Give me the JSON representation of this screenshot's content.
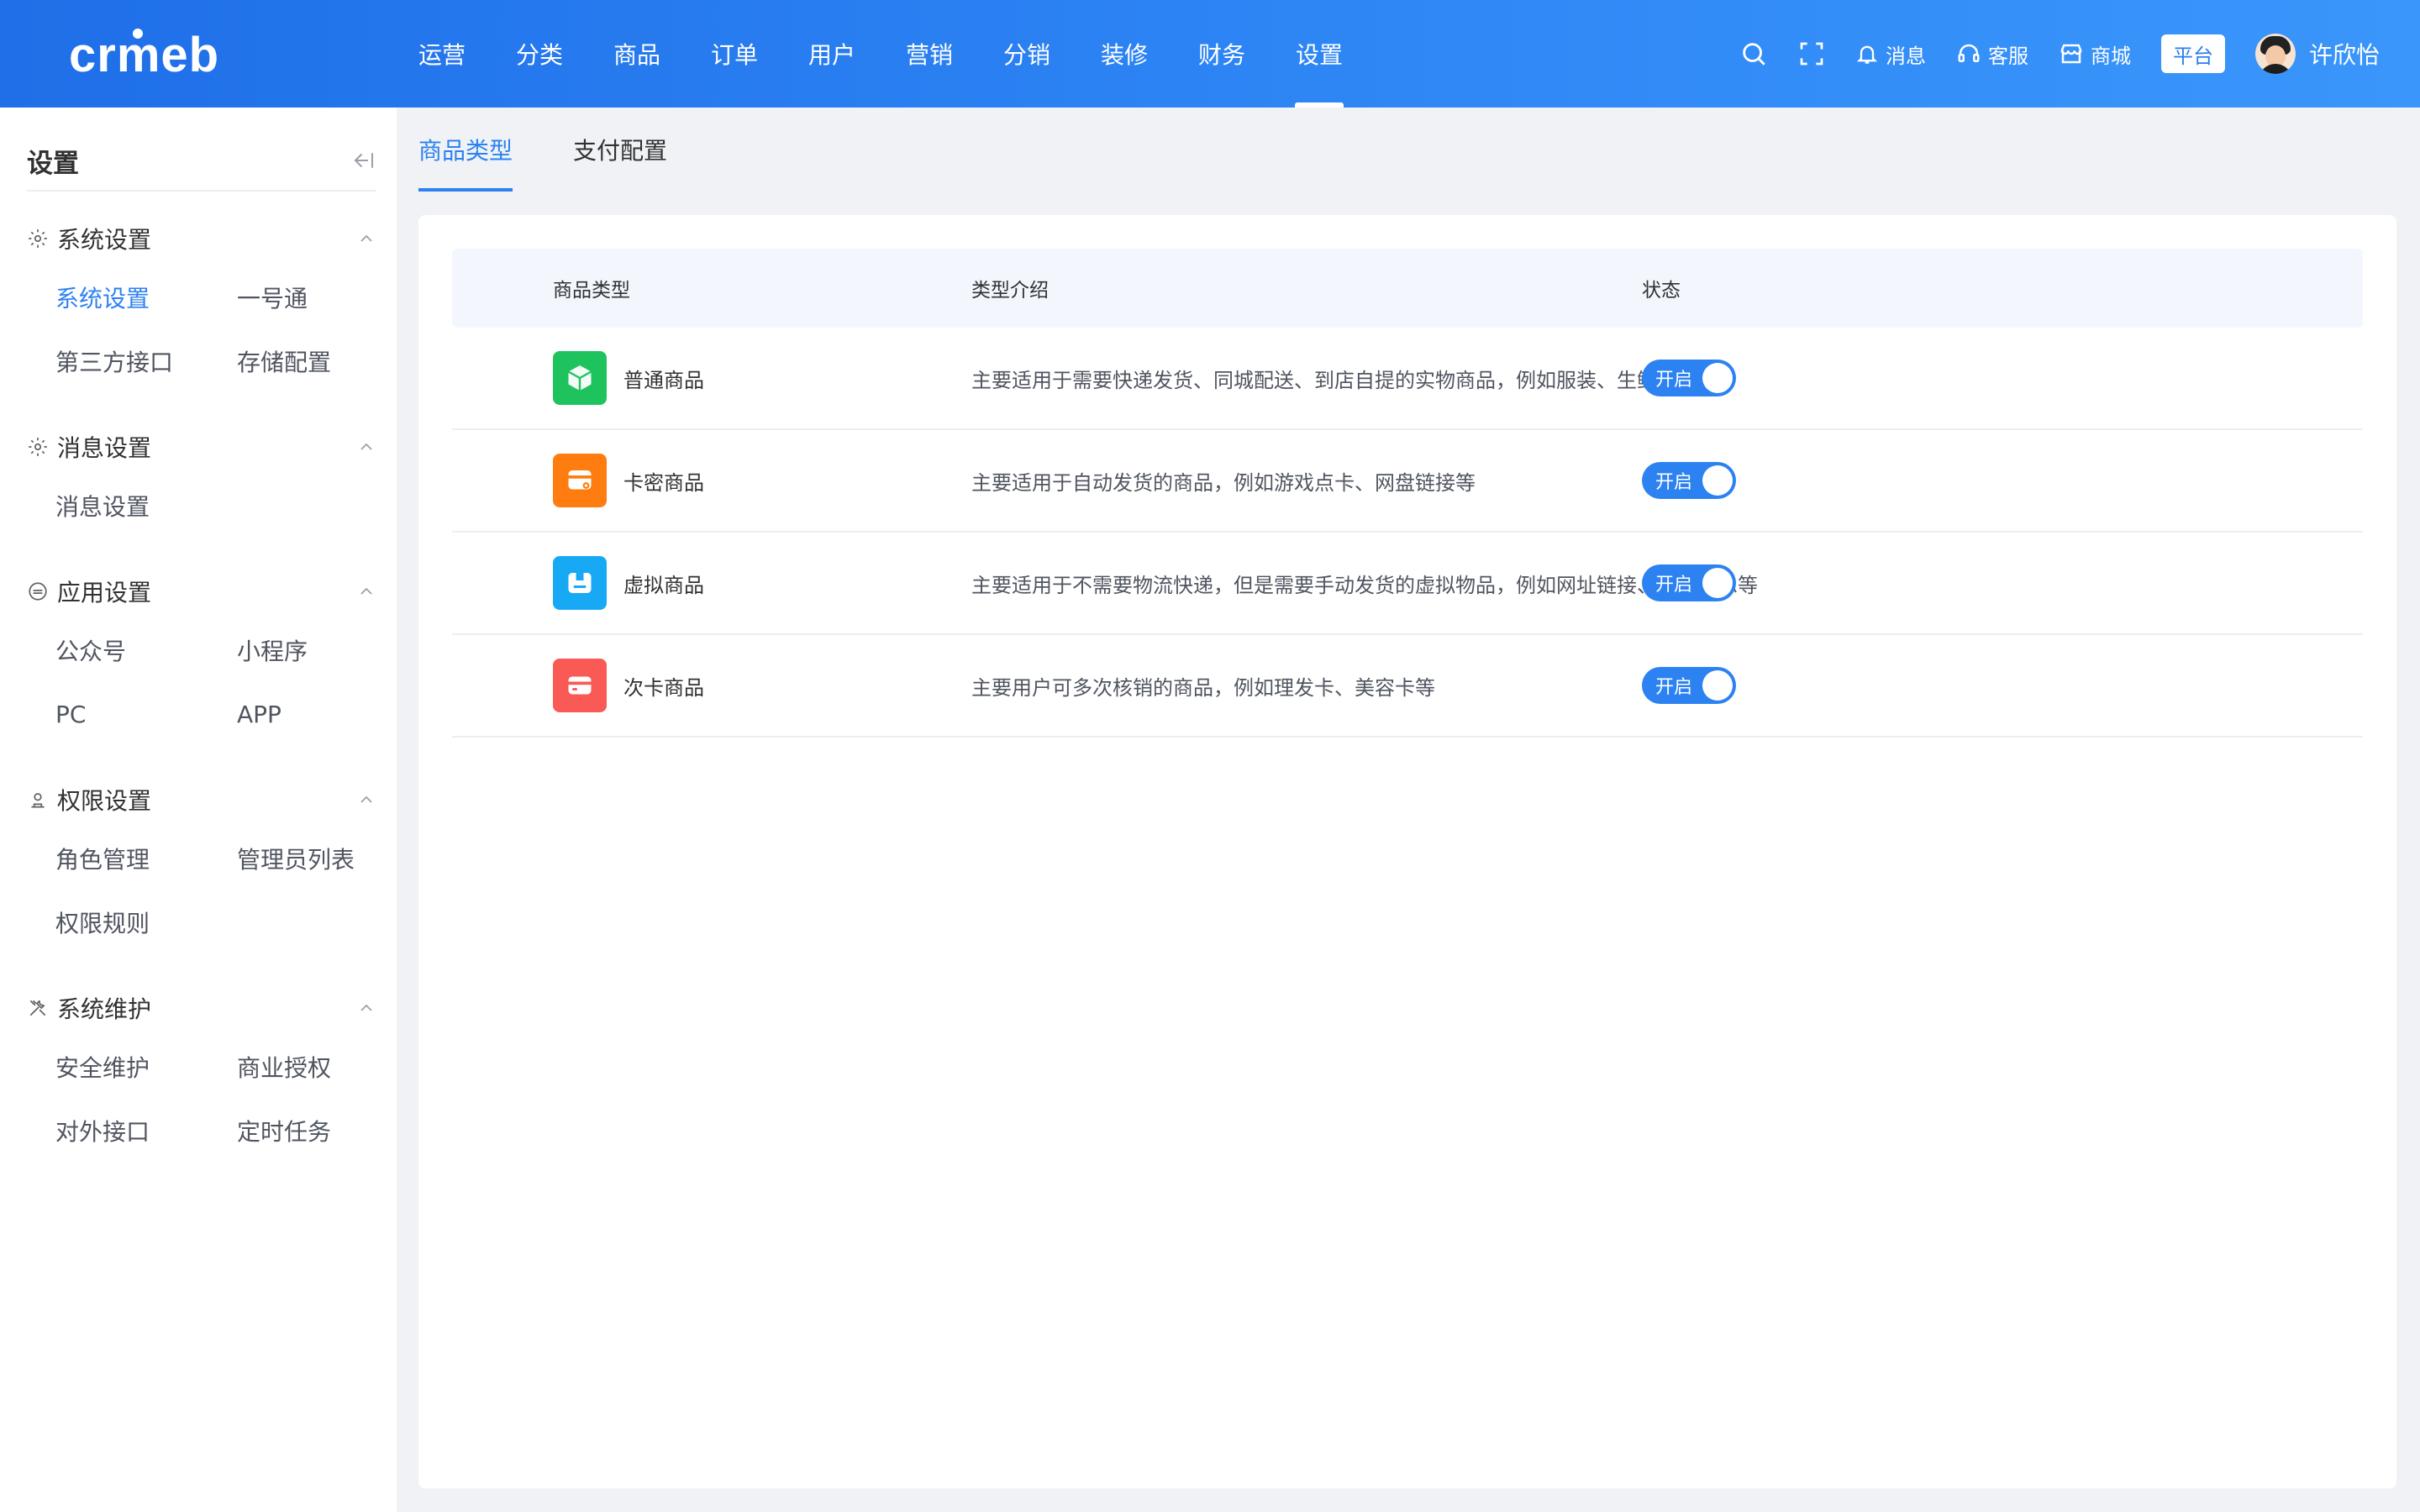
{
  "brand": {
    "logo_text": "crmeb"
  },
  "topnav": {
    "items": [
      {
        "label": "运营"
      },
      {
        "label": "分类"
      },
      {
        "label": "商品"
      },
      {
        "label": "订单"
      },
      {
        "label": "用户"
      },
      {
        "label": "营销"
      },
      {
        "label": "分销"
      },
      {
        "label": "装修"
      },
      {
        "label": "财务"
      },
      {
        "label": "设置"
      }
    ],
    "active_index": 9
  },
  "topright": {
    "message_label": "消息",
    "service_label": "客服",
    "mall_label": "商城",
    "platform_label": "平台",
    "username": "许欣怡"
  },
  "sidebar": {
    "title": "设置",
    "groups": [
      {
        "label": "系统设置",
        "icon": "gear-icon",
        "items": [
          "系统设置",
          "一号通",
          "第三方接口",
          "存储配置"
        ]
      },
      {
        "label": "消息设置",
        "icon": "gear-icon",
        "items": [
          "消息设置"
        ]
      },
      {
        "label": "应用设置",
        "icon": "app-icon",
        "items": [
          "公众号",
          "小程序",
          "PC",
          "APP"
        ]
      },
      {
        "label": "权限设置",
        "icon": "user-icon",
        "items": [
          "角色管理",
          "管理员列表",
          "权限规则"
        ]
      },
      {
        "label": "系统维护",
        "icon": "tools-icon",
        "items": [
          "安全维护",
          "商业授权",
          "对外接口",
          "定时任务"
        ]
      }
    ],
    "active_item": "系统设置"
  },
  "tabs": [
    {
      "label": "商品类型"
    },
    {
      "label": "支付配置"
    }
  ],
  "table": {
    "headers": {
      "type": "商品类型",
      "desc": "类型介绍",
      "status": "状态"
    },
    "rows": [
      {
        "name": "普通商品",
        "desc": "主要适用于需要快递发货、同城配送、到店自提的实物商品，例如服装、生鲜等",
        "status": "开启",
        "icon_color": "#1ec35e",
        "icon": "cube-icon"
      },
      {
        "name": "卡密商品",
        "desc": "主要适用于自动发货的商品，例如游戏点卡、网盘链接等",
        "status": "开启",
        "icon_color": "#ff7d10",
        "icon": "card-key-icon"
      },
      {
        "name": "虚拟商品",
        "desc": "主要适用于不需要物流快递，但是需要手动发货的虚拟物品，例如网址链接、账号信息等",
        "status": "开启",
        "icon_color": "#17a9f4",
        "icon": "box-icon"
      },
      {
        "name": "次卡商品",
        "desc": "主要用户可多次核销的商品，例如理发卡、美容卡等",
        "status": "开启",
        "icon_color": "#fa5a55",
        "icon": "pass-card-icon"
      }
    ]
  },
  "colors": {
    "accent": "#2d82f2",
    "topbar_start": "#1f6fe8",
    "topbar_end": "#3a96fb"
  }
}
